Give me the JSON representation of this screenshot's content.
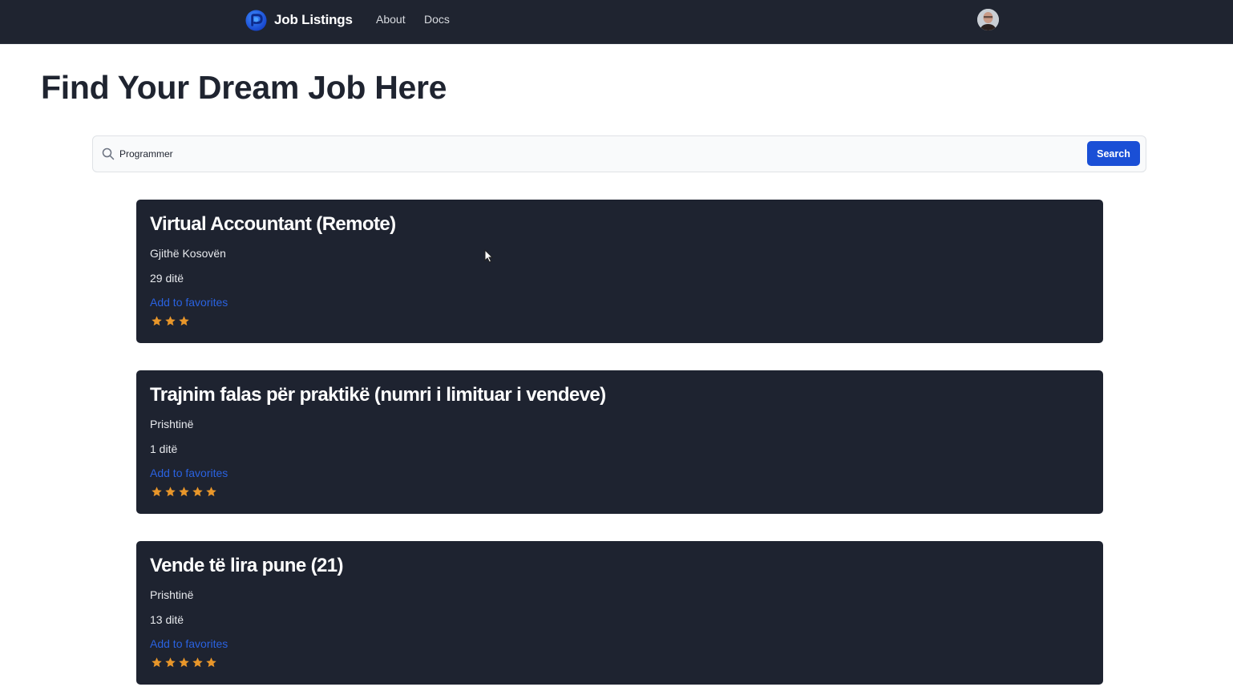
{
  "navbar": {
    "brand_name": "Job Listings",
    "links": [
      "About",
      "Docs"
    ],
    "brand_color": "#1f5fe0"
  },
  "page": {
    "title": "Find Your Dream Job Here"
  },
  "search": {
    "value": "Programmer",
    "placeholder": "Search",
    "button_label": "Search",
    "button_color": "#1a4fd6"
  },
  "jobs": [
    {
      "title": "Virtual Accountant (Remote)",
      "location": "Gjithë Kosovën",
      "days": "29 ditë",
      "favorite_label": "Add to favorites",
      "rating": 3
    },
    {
      "title": "Trajnim falas për praktikë (numri i limituar i vendeve)",
      "location": "Prishtinë",
      "days": "1 ditë",
      "favorite_label": "Add to favorites",
      "rating": 5
    },
    {
      "title": "Vende të lira pune (21)",
      "location": "Prishtinë",
      "days": "13 ditë",
      "favorite_label": "Add to favorites",
      "rating": 5
    }
  ],
  "colors": {
    "card_bg": "#1e2330",
    "star": "#e8962a",
    "link": "#2a62e0"
  }
}
